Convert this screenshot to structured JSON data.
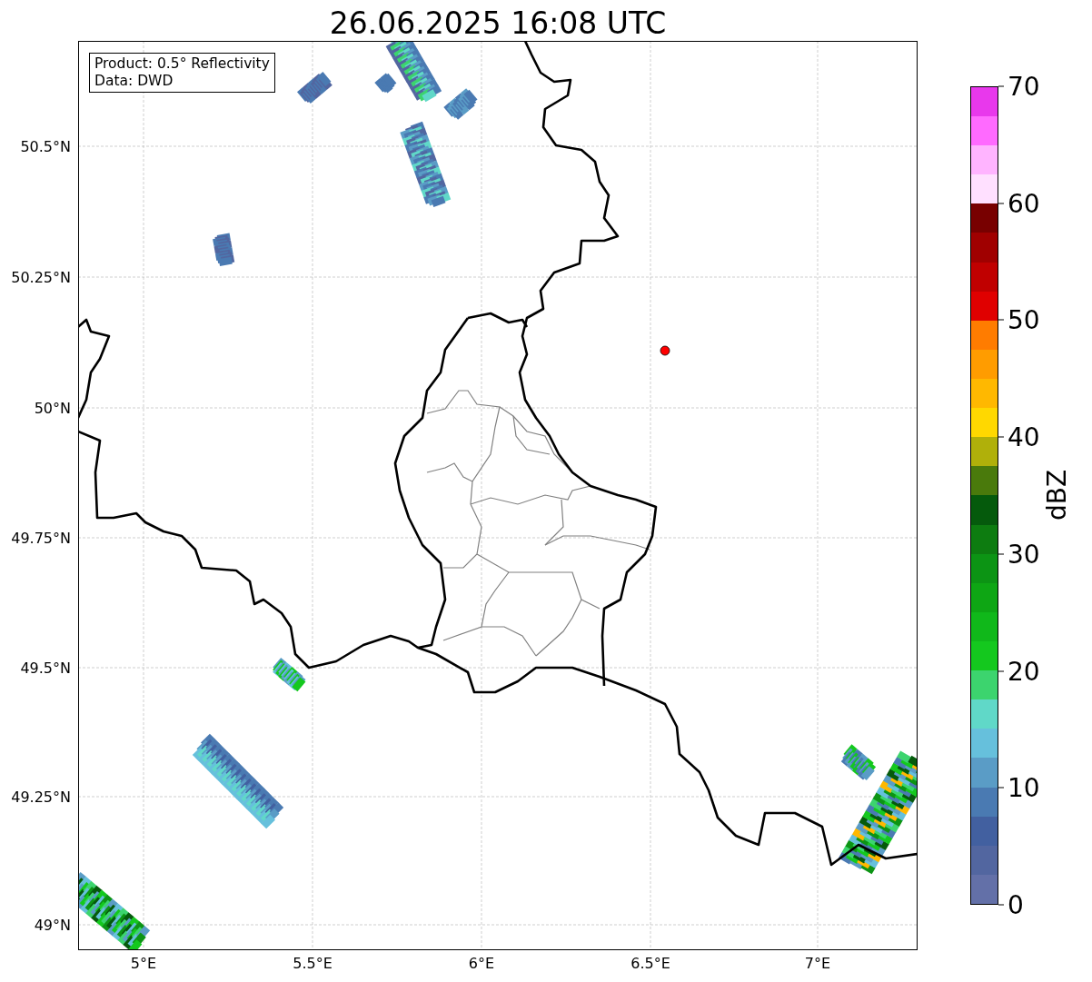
{
  "title": "26.06.2025 16:08 UTC",
  "legend": {
    "lines": [
      "Product: 0.5° Reflectivity",
      "Data: DWD"
    ]
  },
  "x_ticks": [
    "5°E",
    "5.5°E",
    "6°E",
    "6.5°E",
    "7°E"
  ],
  "y_ticks": [
    "50.5°N",
    "50.25°N",
    "50°N",
    "49.75°N",
    "49.5°N",
    "49.25°N",
    "49°N"
  ],
  "colorbar": {
    "label": "dBZ",
    "ticks": [
      "70",
      "60",
      "50",
      "40",
      "30",
      "20",
      "10",
      "0"
    ],
    "segments": [
      {
        "color": "#6370a8"
      },
      {
        "color": "#5266a0"
      },
      {
        "color": "#4260a0"
      },
      {
        "color": "#4a7ab2"
      },
      {
        "color": "#5a9cc6"
      },
      {
        "color": "#66c0dc"
      },
      {
        "color": "#60d8c8"
      },
      {
        "color": "#3cd46e"
      },
      {
        "color": "#14c81e"
      },
      {
        "color": "#10b81a"
      },
      {
        "color": "#0ea614"
      },
      {
        "color": "#0c9414"
      },
      {
        "color": "#0d7c10"
      },
      {
        "color": "#055a0c"
      },
      {
        "color": "#4a7a0c"
      },
      {
        "color": "#b0b00a"
      },
      {
        "color": "#ffd800"
      },
      {
        "color": "#ffb800"
      },
      {
        "color": "#ff9c00"
      },
      {
        "color": "#ff7c00"
      },
      {
        "color": "#e00000"
      },
      {
        "color": "#c00000"
      },
      {
        "color": "#a00000"
      },
      {
        "color": "#780000"
      },
      {
        "color": "#ffe0ff"
      },
      {
        "color": "#ffb4ff"
      },
      {
        "color": "#ff6aff"
      },
      {
        "color": "#e838ec"
      }
    ]
  }
}
